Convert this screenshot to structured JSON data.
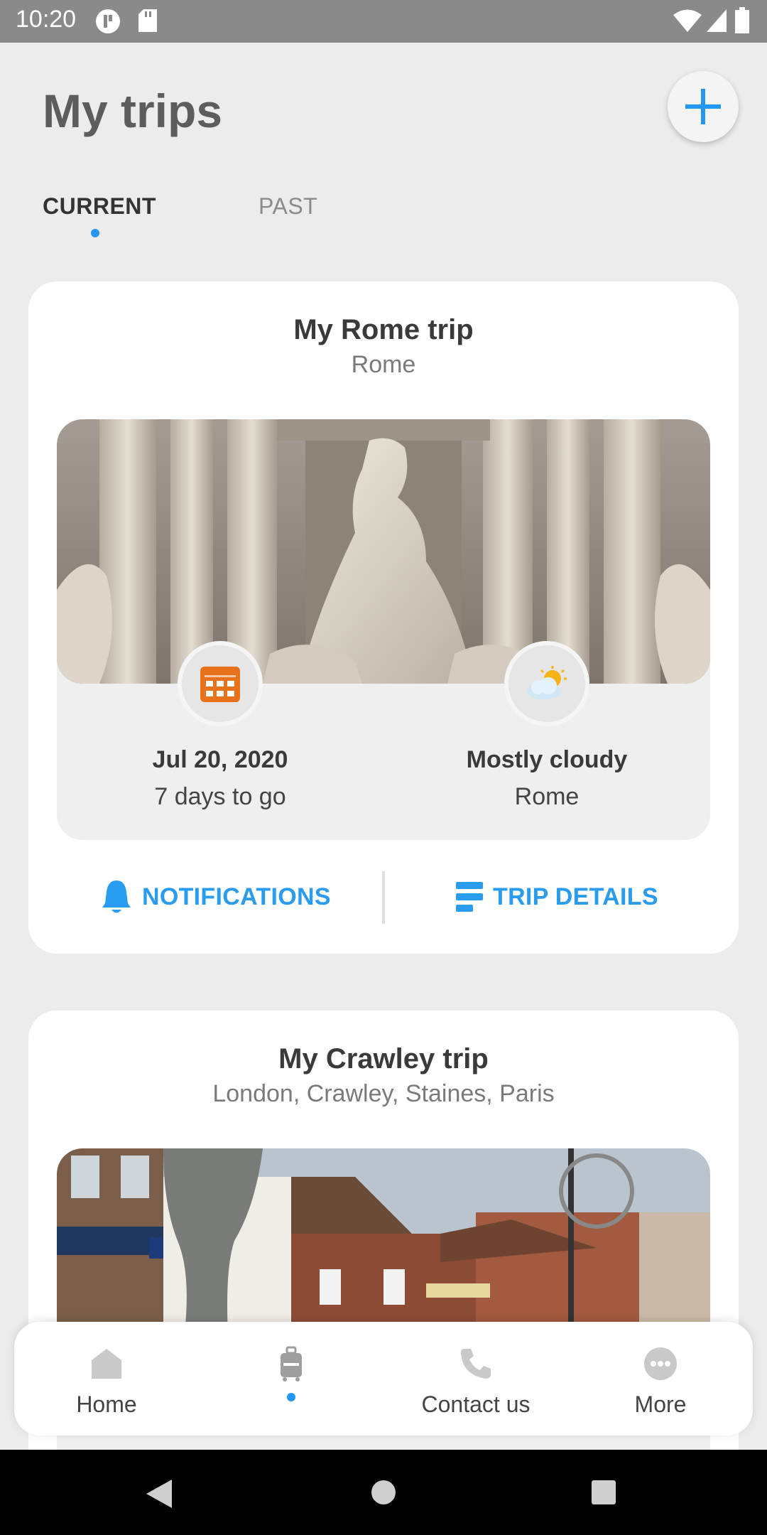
{
  "status": {
    "time": "10:20"
  },
  "header": {
    "title": "My trips"
  },
  "tabs": [
    {
      "label": "CURRENT",
      "active": true
    },
    {
      "label": "PAST",
      "active": false
    }
  ],
  "trips": [
    {
      "title": "My Rome trip",
      "destinations": "Rome",
      "date": "Jul 20, 2020",
      "countdown": "7 days to go",
      "weather": "Mostly cloudy",
      "weather_location": "Rome",
      "actions": {
        "notifications": "NOTIFICATIONS",
        "details": "TRIP DETAILS"
      }
    },
    {
      "title": "My Crawley trip",
      "destinations": "London, Crawley, Staines, Paris"
    }
  ],
  "bottom_nav": {
    "items": [
      {
        "label": "Home",
        "icon": "home-icon"
      },
      {
        "label": "",
        "icon": "luggage-icon",
        "active": true
      },
      {
        "label": "Contact us",
        "icon": "phone-icon"
      },
      {
        "label": "More",
        "icon": "more-icon"
      }
    ]
  },
  "colors": {
    "accent": "#2196f3",
    "calendar": "#e8721c",
    "background": "#ececec"
  }
}
